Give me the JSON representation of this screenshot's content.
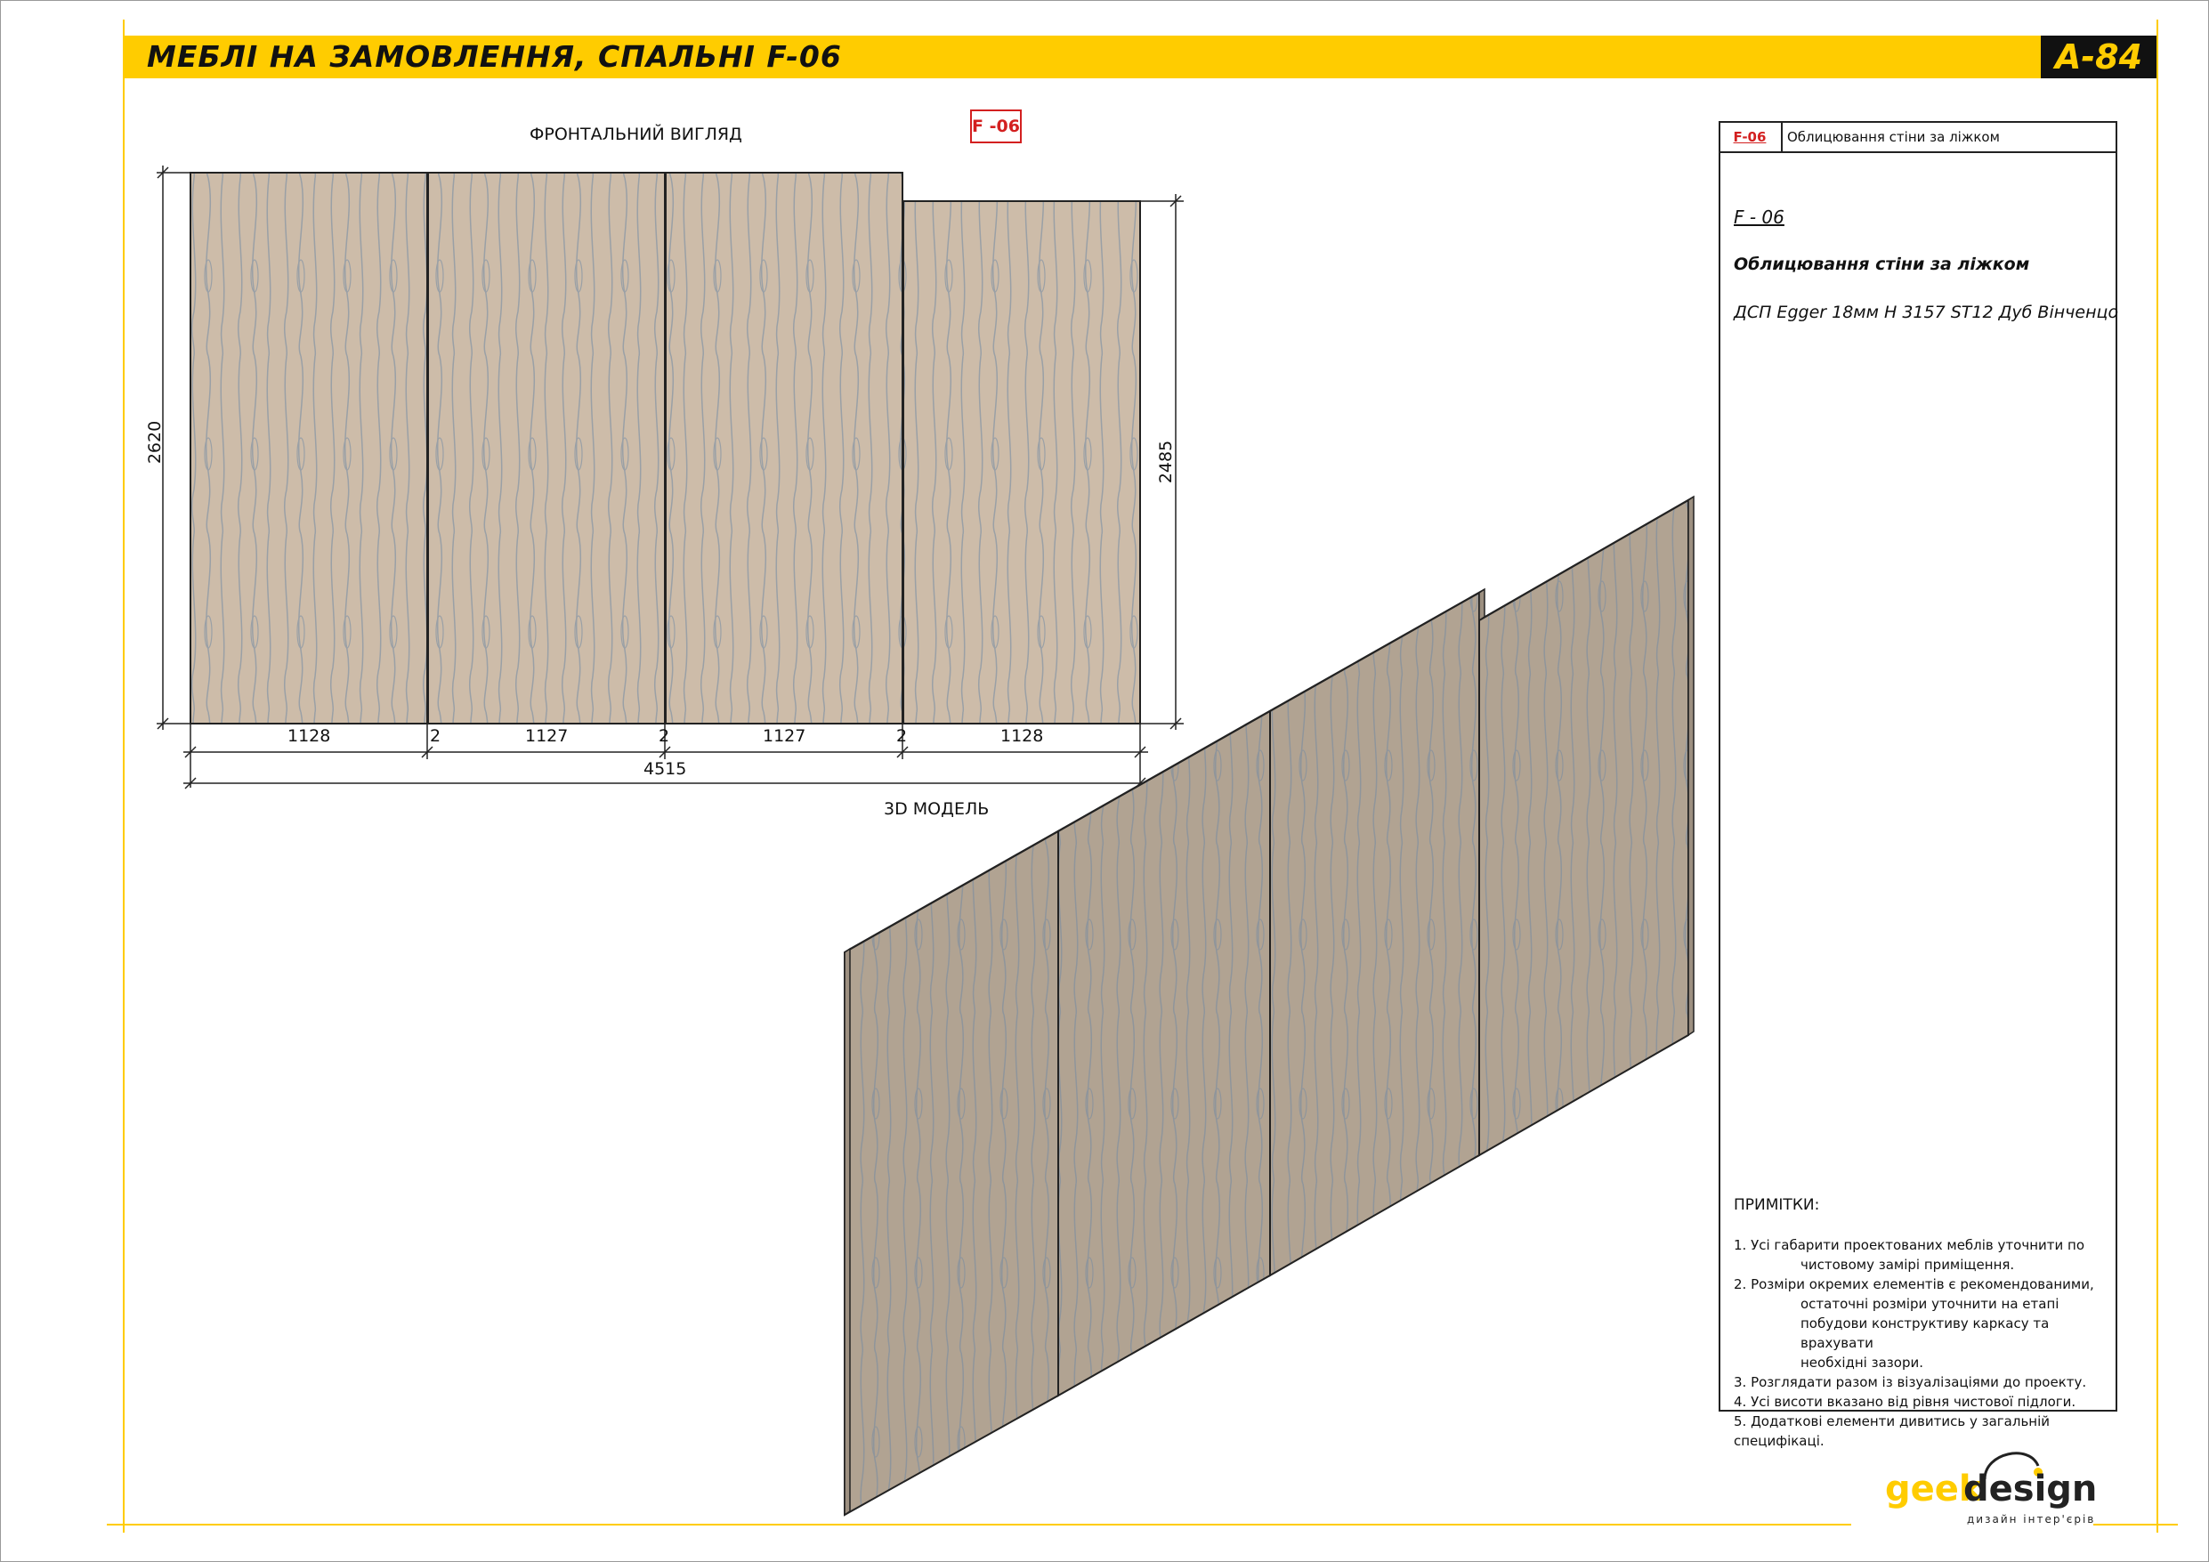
{
  "header": {
    "title": "МЕБЛІ НА ЗАМОВЛЕННЯ, СПАЛЬНІ F-06",
    "sheet": "А-84"
  },
  "drawing": {
    "front_label": "ФРОНТАЛЬНИЙ ВИГЛЯД",
    "model_label": "3D МОДЕЛЬ",
    "tag": "F -06",
    "dims": {
      "height_left": "2620",
      "height_right": "2485",
      "panel_1": "1128",
      "gap_1": "2",
      "panel_2": "1127",
      "gap_2": "2",
      "panel_3": "1127",
      "gap_3": "2",
      "panel_4": "1128",
      "total": "4515"
    }
  },
  "panel": {
    "code": "F-06",
    "name": "Облицювання стіни за ліжком",
    "id": "F - 06",
    "description": "Облицювання стіни за ліжком",
    "material": "ДСП Egger 18мм H 3157 ST12 Дуб Вінченцо",
    "notes_title": "ПРИМІТКИ:",
    "notes": {
      "n1a": "1. Усі габарити проектованих меблів уточнити по",
      "n1b": "чистовому замірі приміщення.",
      "n2a": "2. Розміри окремих елементів є рекомендованими,",
      "n2b": "остаточні розміри уточнити на етапі",
      "n2c": "побудови конструктиву каркасу та врахувати",
      "n2d": "необхідні зазори.",
      "n3": "3. Розглядати разом із візуалізаціями до проекту.",
      "n4": "4. Усі висоти вказано від рівня чистової підлоги.",
      "n5": "5. Додаткові елементи дивитись у загальній специфікаці."
    }
  },
  "logo": {
    "geek": "geek",
    "design": "design",
    "sub": "дизайн інтер'єрів"
  },
  "colors": {
    "accent": "#ffcc00",
    "tag_red": "#d32020",
    "wood_front": "#cdbca9",
    "wood_3d": "#b1a392"
  }
}
